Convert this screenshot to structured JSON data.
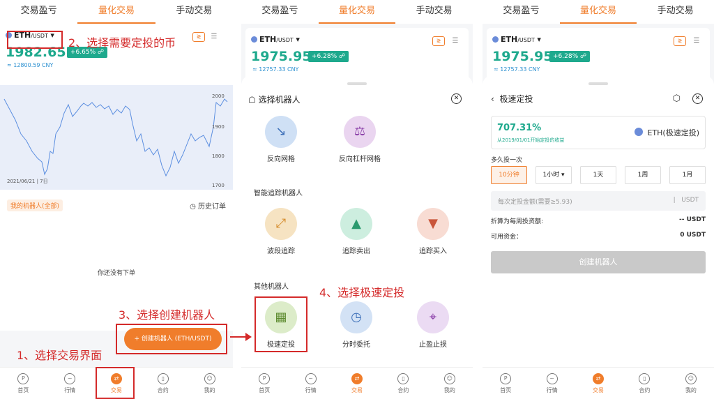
{
  "tabs": [
    "交易盈亏",
    "量化交易",
    "手动交易"
  ],
  "p1": {
    "coin": "ETH",
    "pair": "/USDT",
    "price": "1982.65",
    "pct": "+6.65%",
    "cny": "≈ 12800.59 CNY",
    "date": "2021/06/21 | 7日",
    "axis": [
      "2000",
      "1900",
      "1800",
      "1700"
    ],
    "my_bots": "我的机器人(全部)",
    "history": "历史订单",
    "empty": "你还没有下单",
    "create": "+ 创建机器人 (ETH/USDT)"
  },
  "p2": {
    "coin": "ETH",
    "pair": "/USDT",
    "price": "1975.95",
    "pct": "+6.28%",
    "cny": "≈ 12757.33 CNY",
    "title": "选择机器人",
    "bots1": [
      "反向网格",
      "反向杠杆网格"
    ],
    "section2": "智能追踪机器人",
    "bots2": [
      "波段追踪",
      "追踪卖出",
      "追踪买入"
    ],
    "section3": "其他机器人",
    "bots3": [
      "极速定投",
      "分时委托",
      "止盈止损"
    ]
  },
  "p3": {
    "coin": "ETH",
    "pair": "/USDT",
    "price": "1975.95",
    "pct": "+6.28%",
    "cny": "≈ 12757.33 CNY",
    "title": "极速定投",
    "yield": "707.31%",
    "yield_sub": "从2019/01/01开始定投的收益",
    "coin_name": "ETH(极速定投)",
    "freq_label": "多久投一次",
    "freqs": [
      "10分钟",
      "1小时 ▾",
      "1天",
      "1周",
      "1月"
    ],
    "amount_ph": "每次定投金额(需要≥5.93)",
    "unit": "USDT",
    "weekly_label": "折算为每周投资额:",
    "weekly_val": "-- USDT",
    "avail_label": "可用资金：",
    "avail_val": "0 USDT",
    "create": "创建机器人"
  },
  "nav": [
    "首页",
    "行情",
    "交易",
    "合约",
    "我的"
  ],
  "annot": [
    "1、选择交易界面",
    "2、选择需要定投的币",
    "3、选择创建机器人",
    "4、选择极速定投"
  ]
}
